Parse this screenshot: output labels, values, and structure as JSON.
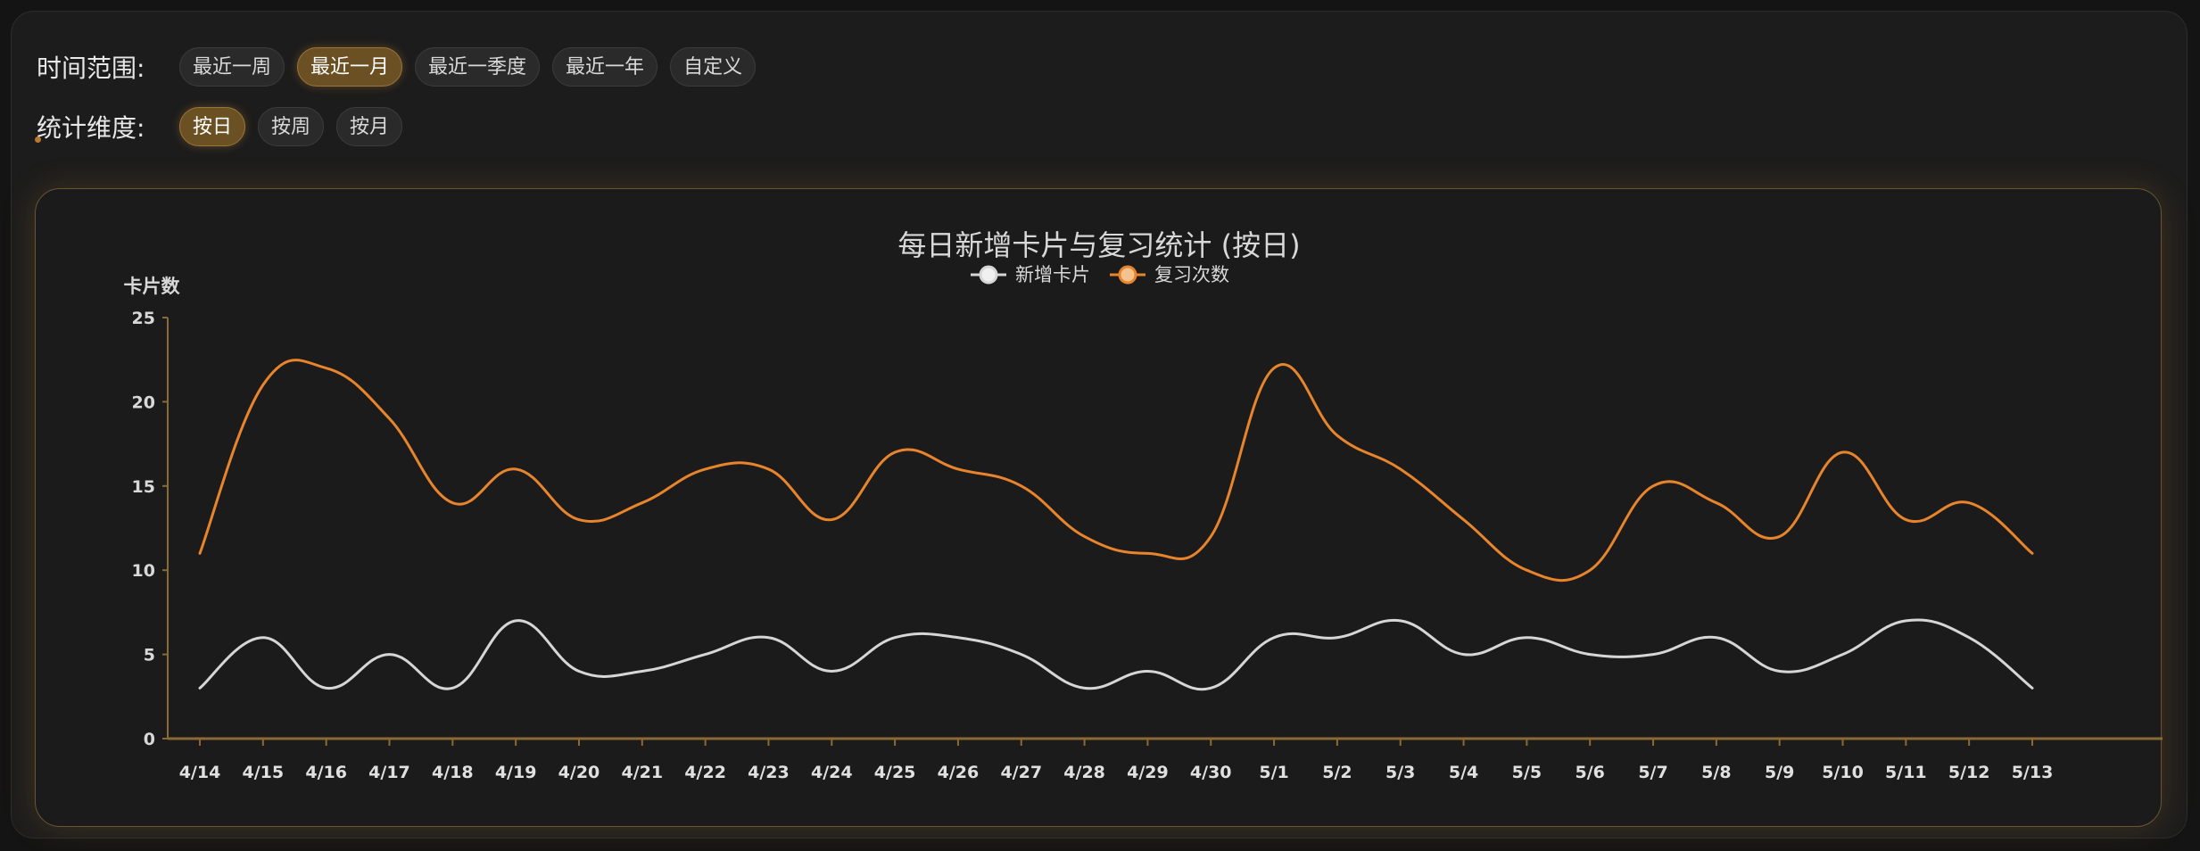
{
  "filters": {
    "time_range": {
      "label": "时间范围:",
      "options": [
        "最近一周",
        "最近一月",
        "最近一季度",
        "最近一年",
        "自定义"
      ],
      "active_index": 1
    },
    "dimension": {
      "label": "统计维度:",
      "options": [
        "按日",
        "按周",
        "按月"
      ],
      "active_index": 0
    }
  },
  "colors": {
    "accent": "#e8852c",
    "new_cards": "#d6d6d6",
    "reviews": "#e8852c",
    "axis": "#8a6a34"
  },
  "chart_data": {
    "type": "line",
    "title": "每日新增卡片与复习统计 (按日)",
    "ylabel": "卡片数",
    "xlabel": "",
    "ylim": [
      0,
      25
    ],
    "yticks": [
      0,
      5,
      10,
      15,
      20,
      25
    ],
    "legend_position": "top-center",
    "grid": false,
    "smooth": true,
    "categories": [
      "4/14",
      "4/15",
      "4/16",
      "4/17",
      "4/18",
      "4/19",
      "4/20",
      "4/21",
      "4/22",
      "4/23",
      "4/24",
      "4/25",
      "4/26",
      "4/27",
      "4/28",
      "4/29",
      "4/30",
      "5/1",
      "5/2",
      "5/3",
      "5/4",
      "5/5",
      "5/6",
      "5/7",
      "5/8",
      "5/9",
      "5/10",
      "5/11",
      "5/12",
      "5/13"
    ],
    "series": [
      {
        "name": "新增卡片",
        "color": "#d6d6d6",
        "values": [
          3,
          6,
          3,
          5,
          3,
          7,
          4,
          4,
          5,
          6,
          4,
          6,
          6,
          5,
          3,
          4,
          3,
          6,
          6,
          7,
          5,
          6,
          5,
          5,
          6,
          4,
          5,
          7,
          6,
          3
        ]
      },
      {
        "name": "复习次数",
        "color": "#e8852c",
        "values": [
          11,
          21,
          22,
          19,
          14,
          16,
          13,
          14,
          16,
          16,
          13,
          17,
          16,
          15,
          12,
          11,
          12,
          22,
          18,
          16,
          13,
          10,
          10,
          15,
          14,
          12,
          17,
          13,
          14,
          11
        ]
      }
    ]
  }
}
